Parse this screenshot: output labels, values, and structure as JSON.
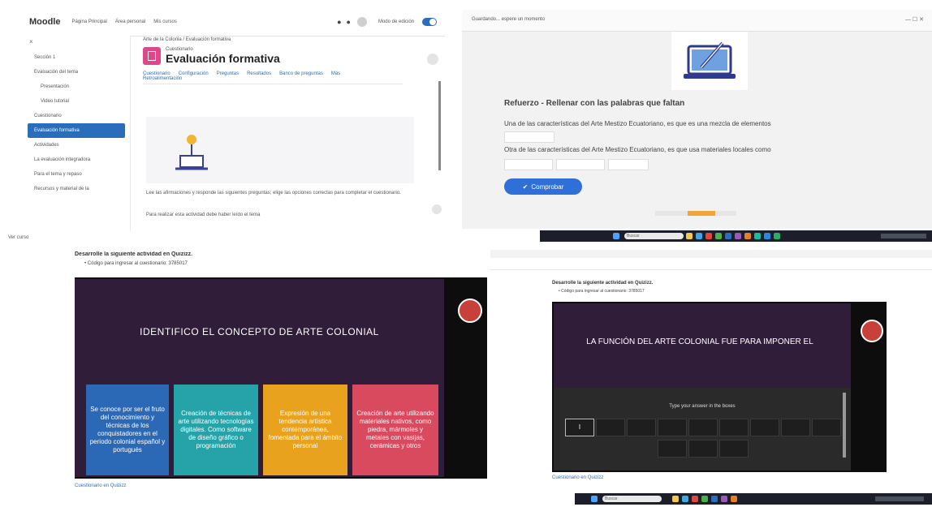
{
  "panel_moodle": {
    "brand": "Moodle",
    "nav": [
      "Página Principal",
      "Área personal",
      "Mis cursos"
    ],
    "edit_mode_label": "Modo de edición",
    "breadcrumb": "Arte de la Colonia / Evaluación formativa",
    "activity_kind": "Cuestionario",
    "title": "Evaluación formativa",
    "tabs": [
      "Cuestionario",
      "Configuración",
      "Preguntas",
      "Resultados",
      "Banco de preguntas",
      "Más"
    ],
    "tab_overflow": "Retroalimentación",
    "sidebar_items": [
      "Sección 1",
      "Evaluación del tema",
      "Presentación",
      "Video tutorial",
      "Cuestionario",
      "Evaluación formativa",
      "Actividades",
      "La evaluación integradora",
      "Para el tema y repaso",
      "Recursos y material de la"
    ],
    "sidebar_active": "Evaluación formativa",
    "body_text": "Lee las afirmaciones y responde las siguientes preguntas; elige las opciones correctas para completar el cuestionario.",
    "footer_text": "Para realizar esta actividad debe haber leído el tema",
    "status_left": "Ver curso"
  },
  "panel_quiz": {
    "header_left": "Guardando... espere un momento",
    "title": "Refuerzo - Rellenar con las palabras que faltan",
    "q1": "Una de las características del Arte Mestizo Ecuatoriano, es que es una mezcla de elementos",
    "q2": "Otra de las características del Arte Mestizo Ecuatoriano, es que usa materiales locales como",
    "button": "Comprobar"
  },
  "panel_slides": {
    "instruction": "Desarrolle la siguiente actividad en Quizizz.",
    "bullet": "Código para ingresar al cuestionario: 3785017",
    "slide_title": "IDENTIFICO EL CONCEPTO DE ARTE COLONIAL",
    "cards": [
      {
        "text": "Se conoce por ser el fruto del conocimiento y técnicas de los conquistadores en el periodo colonial español y portugués",
        "color": "#2b68b5"
      },
      {
        "text": "Creación de técnicas de arte utilizando tecnologías digitales. Como software de diseño gráfico o programación",
        "color": "#26a3a8"
      },
      {
        "text": "Expresión de una tendencia artística contemporánea, fomentada para el ámbito personal",
        "color": "#e9a21d"
      },
      {
        "text": "Creación de arte utilizando materiales nativos, como piedra, mármoles y metales con vasijas, cerámicas y otros",
        "color": "#d94a5e"
      }
    ],
    "footer": "Cuestionario en Quizizz"
  },
  "panel_slides2": {
    "instruction": "Desarrolle la siguiente actividad en Quizizz.",
    "bullet": "Código para ingresar al cuestionario: 3785017",
    "slide_title": "LA FUNCIÓN DEL ARTE COLONIAL FUE PARA IMPONER EL",
    "answer_prompt": "Type your answer in the boxes",
    "first_box": "I",
    "footer": "Cuestionario en Quizizz"
  },
  "taskbar": {
    "search_placeholder": "Buscar"
  }
}
